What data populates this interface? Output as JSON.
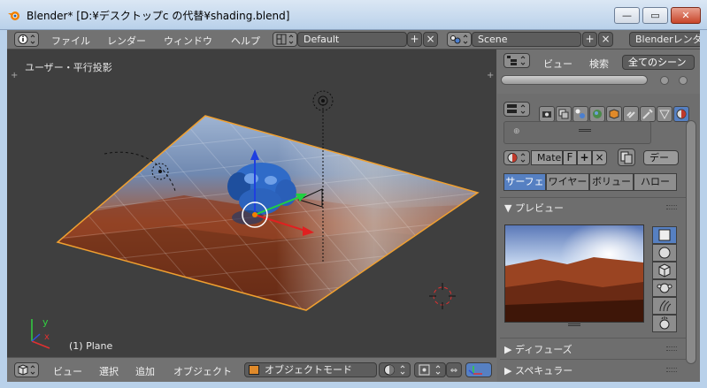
{
  "window": {
    "title": "Blender* [D:¥デスクトップc の代替¥shading.blend]"
  },
  "menubar": {
    "items": [
      "ファイル",
      "レンダー",
      "ウィンドウ",
      "ヘルプ"
    ],
    "layout_value": "Default",
    "scene_value": "Scene",
    "engine_value": "Blenderレンダ"
  },
  "viewport": {
    "view_label": "ユーザー・平行投影",
    "object_info": "(1) Plane",
    "axis_x": "x",
    "axis_y": "y"
  },
  "bottombar": {
    "items": [
      "ビュー",
      "選択",
      "追加",
      "オブジェクト"
    ],
    "mode_value": "オブジェクトモード"
  },
  "outliner": {
    "view_label": "ビュー",
    "search_label": "検索",
    "filter_value": "全てのシーン"
  },
  "material": {
    "name_value": "Mate",
    "f_label": "F",
    "data_value": "デー",
    "tabs": [
      "サーフェ",
      "ワイヤー",
      "ボリュー",
      "ハロー"
    ],
    "active_tab": "サーフェ"
  },
  "sections": {
    "preview": "プレビュー",
    "diffuse": "ディフューズ",
    "specular": "スペキュラー"
  },
  "colors": {
    "accent_blue": "#5680c2",
    "panel_bg": "#727272",
    "viewport_bg": "#3f3f3f",
    "selection_orange": "#f0a030"
  }
}
